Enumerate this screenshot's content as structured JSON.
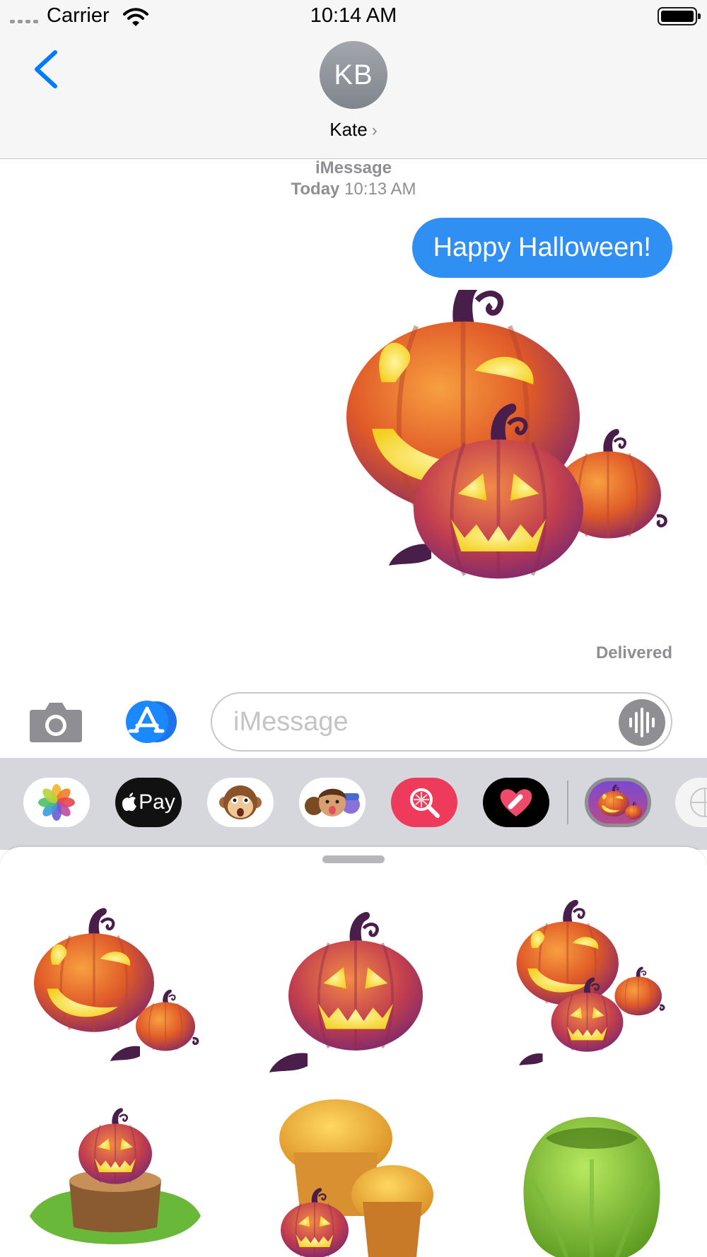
{
  "status_bar": {
    "carrier": "Carrier",
    "time": "10:14 AM"
  },
  "header": {
    "avatar_initials": "KB",
    "contact_name": "Kate"
  },
  "conversation": {
    "service": "iMessage",
    "timestamp_day": "Today",
    "timestamp_time": "10:13 AM",
    "message": "Happy Halloween!",
    "status": "Delivered"
  },
  "input": {
    "placeholder": "iMessage"
  },
  "apps": [
    {
      "name": "Photos",
      "icon": "photos-icon"
    },
    {
      "name": "Apple Pay",
      "label": "Pay",
      "icon": "apple-pay-icon"
    },
    {
      "name": "Animoji",
      "icon": "monkey-animoji-icon"
    },
    {
      "name": "Memoji",
      "icon": "memoji-icon"
    },
    {
      "name": "Images Search",
      "icon": "image-search-icon"
    },
    {
      "name": "Digital Touch",
      "icon": "digital-touch-icon"
    },
    {
      "name": "Halloween Stickers",
      "icon": "pumpkin-sticker-icon"
    },
    {
      "name": "More",
      "icon": "partial-app-icon"
    }
  ],
  "stickers": [
    {
      "icon": "pumpkin-pair-sticker"
    },
    {
      "icon": "jack-o-lantern-sticker"
    },
    {
      "icon": "pumpkin-group-sticker"
    },
    {
      "icon": "pumpkin-on-stump-sticker"
    },
    {
      "icon": "muffins-pumpkin-sticker"
    },
    {
      "icon": "green-jelly-sticker"
    }
  ],
  "colors": {
    "accent": "#007aff",
    "bubble": "#2f8ff3",
    "pumpkin": "#e8642a",
    "secondary_text": "#8e8e93"
  }
}
